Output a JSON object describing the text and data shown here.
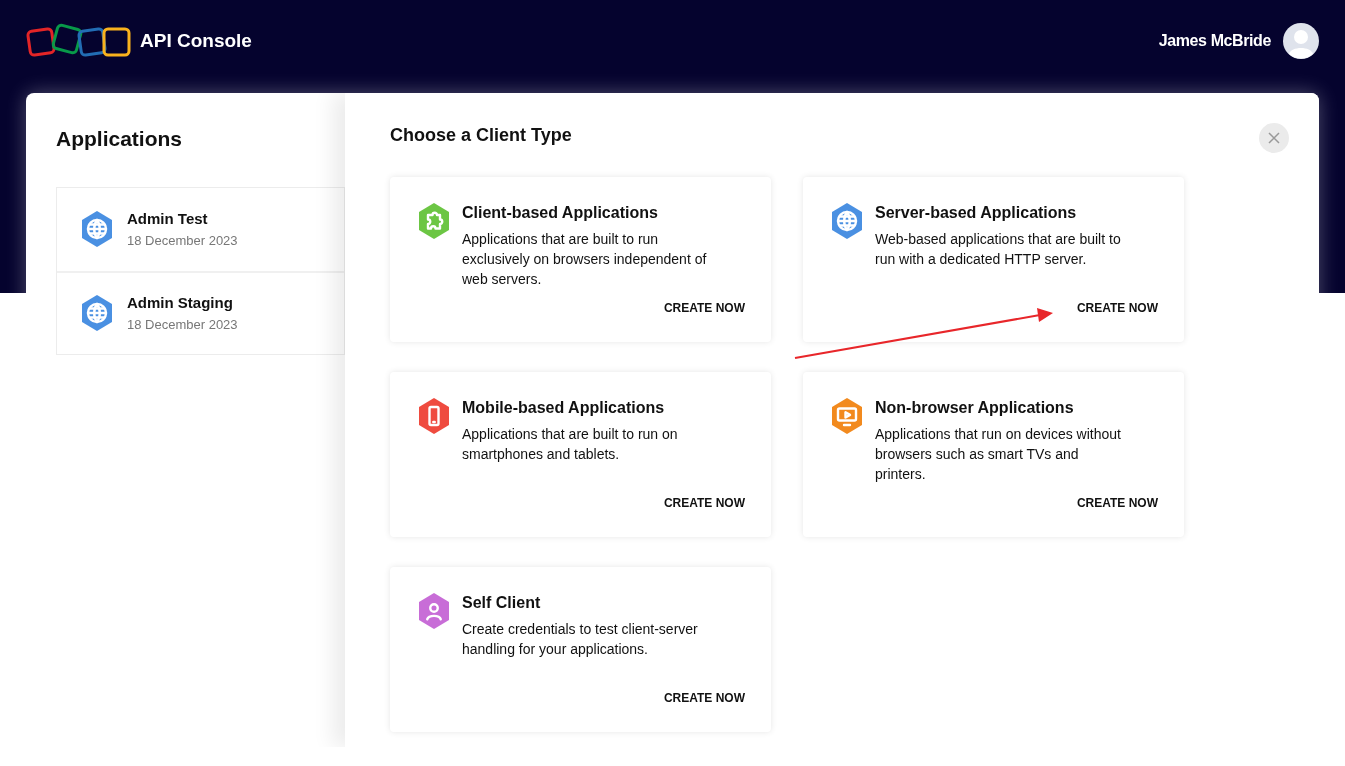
{
  "header": {
    "title": "API Console",
    "user": "James McBride"
  },
  "applications": {
    "title": "Applications",
    "items": [
      {
        "name": "Admin Test",
        "date": "18 December 2023"
      },
      {
        "name": "Admin Staging",
        "date": "18 December 2023"
      }
    ]
  },
  "dialog": {
    "title": "Choose a Client Type",
    "cards": [
      {
        "kind": "puzzle",
        "color": "#6cc644",
        "title": "Client-based Applications",
        "description": "Applications that are built to run exclusively on browsers independent of web servers.",
        "action": "CREATE NOW"
      },
      {
        "kind": "globe",
        "color": "#4a90e2",
        "title": "Server-based Applications",
        "description": "Web-based applications that are built to run with a dedicated HTTP server.",
        "action": "CREATE NOW"
      },
      {
        "kind": "phone",
        "color": "#ef4b3f",
        "title": "Mobile-based Applications",
        "description": "Applications that are built to run on smartphones and tablets.",
        "action": "CREATE NOW"
      },
      {
        "kind": "monitor",
        "color": "#f28a1e",
        "title": "Non-browser Applications",
        "description": "Applications that run on devices without browsers such as smart TVs and printers.",
        "action": "CREATE NOW"
      },
      {
        "kind": "person",
        "color": "#c86dd7",
        "title": "Self Client",
        "description": "Create credentials to test client-server handling for your applications.",
        "action": "CREATE NOW"
      }
    ]
  }
}
